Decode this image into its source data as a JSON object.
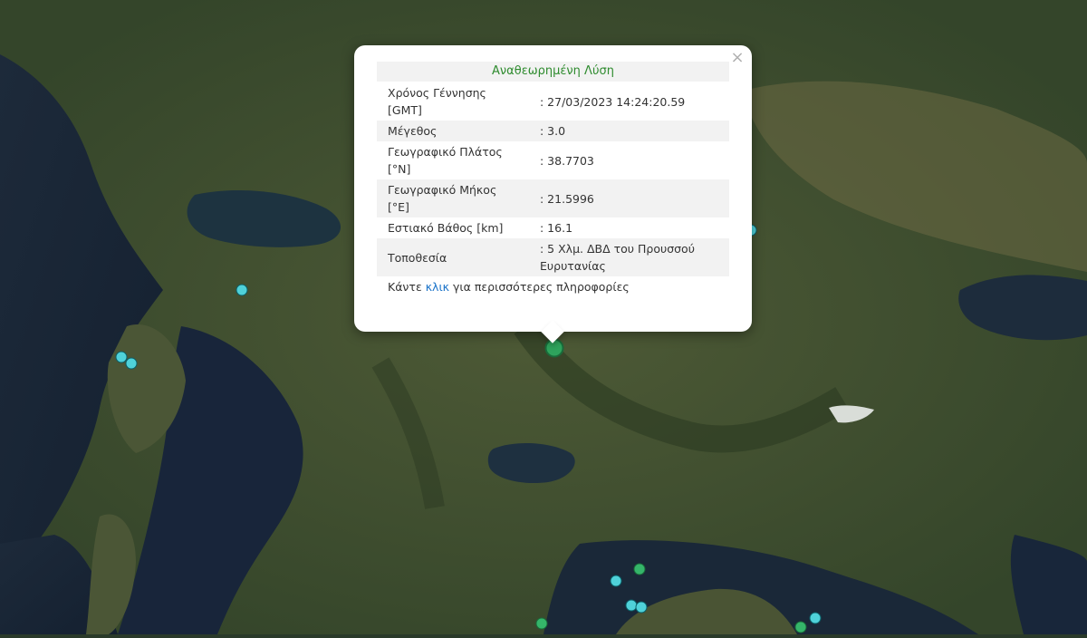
{
  "popup": {
    "title": "Αναθεωρημένη Λύση",
    "close_glyph": "×",
    "rows": [
      {
        "label": "Χρόνος Γέννησης [GMT]",
        "value": ": 27/03/2023 14:24:20.59"
      },
      {
        "label": "Μέγεθος",
        "value": ": 3.0"
      },
      {
        "label": "Γεωγραφικό Πλάτος [°N]",
        "value": ": 38.7703"
      },
      {
        "label": "Γεωγραφικό Μήκος [°E]",
        "value": ": 21.5996"
      },
      {
        "label": "Εστιακό Βάθος [km]",
        "value": ": 16.1"
      },
      {
        "label": "Τοποθεσία",
        "value": ": 5 Χλμ. ΔΒΔ του Προυσσού Ευρυτανίας"
      }
    ],
    "footer_prefix": "Κάντε ",
    "footer_link": "κλικ",
    "footer_suffix": " για περισσότερες πληροφορίες"
  },
  "markers": {
    "colors": {
      "cyan": "#4fd1d9",
      "green": "#35b56a"
    }
  }
}
